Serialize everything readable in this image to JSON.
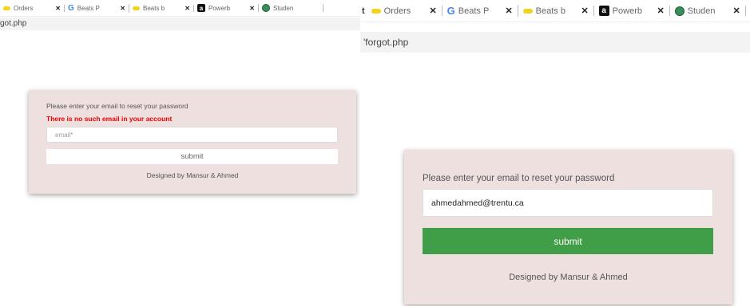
{
  "screenshots": [
    {
      "tabs": [
        {
          "icon": "yellow-tab-icon",
          "title": "Orders"
        },
        {
          "icon": "google-icon",
          "title": "Beats P"
        },
        {
          "icon": "yellow-tab-icon",
          "title": "Beats b"
        },
        {
          "icon": "amazon-icon",
          "title": "Powerb"
        },
        {
          "icon": "globe-icon",
          "title": "Studen"
        }
      ],
      "tab_close": "✕",
      "url": "got.php",
      "form": {
        "prompt": "Please enter your email to reset your password",
        "error": "There is no such email in your account",
        "email_placeholder": "email*",
        "email_value": "",
        "submit_label": "submit",
        "credit": "Designed by Mansur & Ahmed",
        "submit_color": "#ffffff"
      }
    },
    {
      "tabs": [
        {
          "icon": "yellow-tab-icon",
          "title": "Orders"
        },
        {
          "icon": "google-icon",
          "title": "Beats P"
        },
        {
          "icon": "yellow-tab-icon",
          "title": "Beats b"
        },
        {
          "icon": "amazon-icon",
          "title": "Powerb"
        },
        {
          "icon": "globe-icon",
          "title": "Studen"
        }
      ],
      "tab_close": "✕",
      "tab_lead": "t",
      "url": "'forgot.php",
      "form": {
        "prompt": "Please enter your email to reset your password",
        "email_value": "ahmedahmed@trentu.ca",
        "submit_label": "submit",
        "credit": "Designed by Mansur & Ahmed",
        "submit_color": "#3f9e47"
      }
    }
  ],
  "icon_glyphs": {
    "google": "G",
    "amazon": "a"
  }
}
